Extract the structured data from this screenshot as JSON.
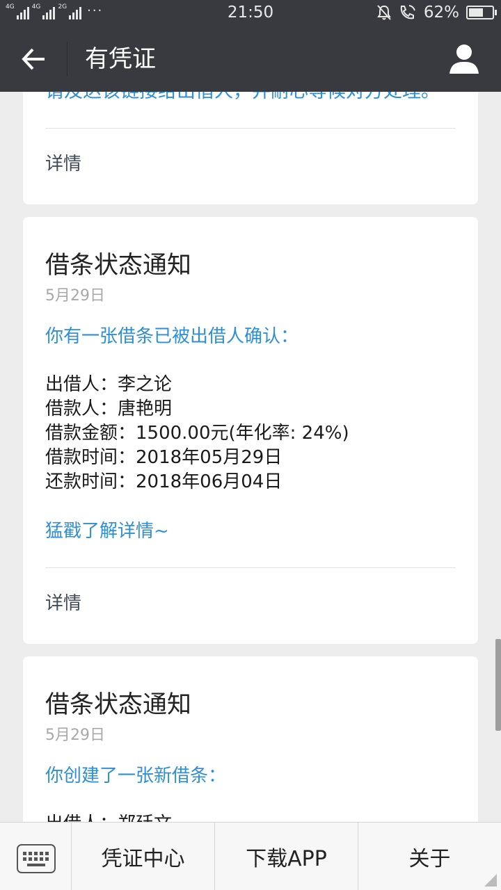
{
  "status_bar": {
    "network_1": "4G",
    "network_2": "4G",
    "network_3": "2G",
    "more": "···",
    "time": "21:50",
    "battery_text": "62%",
    "battery_level": 0.62,
    "icons": [
      "mute-bell-icon",
      "volte-call-icon",
      "battery-icon"
    ]
  },
  "header": {
    "title": "有凭证",
    "back_icon": "arrow-left-icon",
    "user_icon": "user-icon"
  },
  "cards": [
    {
      "partial_text": "请及达该链接给出借人，并耐心等候对方处理。",
      "detail": "详情"
    },
    {
      "title": "借条状态通知",
      "date": "5月29日",
      "intro": "你有一张借条已被出借人确认：",
      "lines": [
        "出借人：李之论",
        "借款人：唐艳明",
        "借款金额：1500.00元(年化率: 24%)",
        "借款时间：2018年05月29日",
        "还款时间：2018年06月04日"
      ],
      "link": "猛戳了解详情~",
      "detail": "详情"
    },
    {
      "title": "借条状态通知",
      "date": "5月29日",
      "intro": "你创建了一张新借条：",
      "lines": [
        "出借人：郑廷文"
      ]
    }
  ],
  "bottom_menu": {
    "keyboard_icon": "keyboard-icon",
    "items": [
      "凭证中心",
      "下载APP",
      "关于"
    ]
  },
  "colors": {
    "header_bg": "#393a3f",
    "page_bg": "#ededed",
    "link_blue": "#2e8fd6"
  }
}
